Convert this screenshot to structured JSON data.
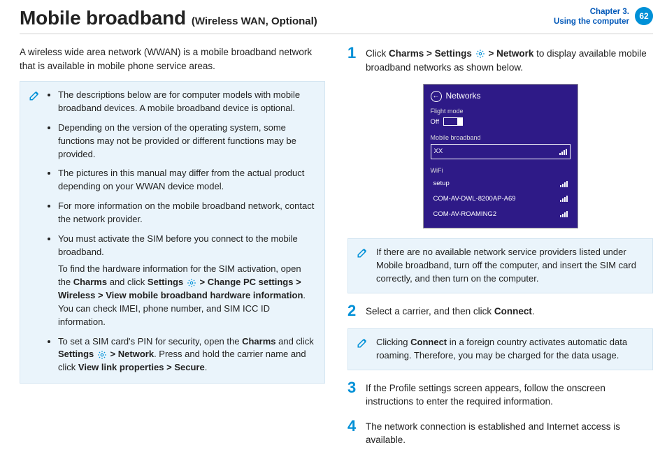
{
  "header": {
    "title": "Mobile broadband",
    "subtitle": "(Wireless WAN, Optional)",
    "chapter_line1": "Chapter 3.",
    "chapter_line2": "Using the computer",
    "page_number": "62"
  },
  "left": {
    "intro": "A wireless wide area network (WWAN) is a mobile broadband network that is available in mobile phone service areas.",
    "notes": {
      "b1": "The descriptions below are for computer models with mobile broadband devices. A mobile broadband device is optional.",
      "b2": "Depending on the version of the operating system, some functions may not be provided or different functions may be provided.",
      "b3": "The pictures in this manual may differ from the actual product depending on your WWAN device model.",
      "b4": "For more information on the mobile broadband network, contact the network provider.",
      "b5": "You must activate the SIM before you connect to the mobile broadband.",
      "b5_sub_pre": "To find the hardware information for the SIM activation, open the ",
      "b5_charms": "Charms",
      "b5_mid1": " and click ",
      "b5_settings": "Settings",
      "b5_gt1": " > ",
      "b5_change": "Change PC settings",
      "b5_gt2": " > ",
      "b5_wireless": "Wireless",
      "b5_gt3": " > ",
      "b5_view": "View mobile broadband hardware information",
      "b5_tail": ". You can check IMEI, phone number, and SIM ICC ID information.",
      "b6_pre": "To set a SIM card's PIN for security, open the ",
      "b6_charms": "Charms",
      "b6_mid": " and click ",
      "b6_settings": "Settings",
      "b6_gt1": " > ",
      "b6_network": "Network",
      "b6_mid2": ". Press and hold the carrier name and click ",
      "b6_view": "View link properties",
      "b6_gt2": " > ",
      "b6_secure": "Secure",
      "b6_period": "."
    }
  },
  "right": {
    "step1": {
      "pre": "Click ",
      "charms": "Charms",
      "gt1": " > ",
      "settings": "Settings",
      "gt2": " > ",
      "network": "Network",
      "post": " to display available mobile broadband networks as shown below."
    },
    "panel": {
      "title": "Networks",
      "flight_label": "Flight mode",
      "flight_state": "Off",
      "mb_label": "Mobile broadband",
      "carrier": "XX",
      "wifi_label": "WiFi",
      "wifi1": "setup",
      "wifi2": "COM-AV-DWL-8200AP-A69",
      "wifi3": "COM-AV-ROAMING2"
    },
    "note1": "If there are no available network service providers listed under Mobile broadband, turn off the computer, and insert the SIM card correctly, and then turn on the computer.",
    "step2": {
      "pre": "Select a carrier, and then click ",
      "connect": "Connect",
      "post": "."
    },
    "note2_pre": "Clicking ",
    "note2_connect": "Connect",
    "note2_post": " in a foreign country activates automatic data roaming. Therefore, you may be charged for the data usage.",
    "step3": "If the Profile settings screen appears, follow the onscreen instructions to enter the required information.",
    "step4": "The network connection is established and Internet access is available."
  }
}
